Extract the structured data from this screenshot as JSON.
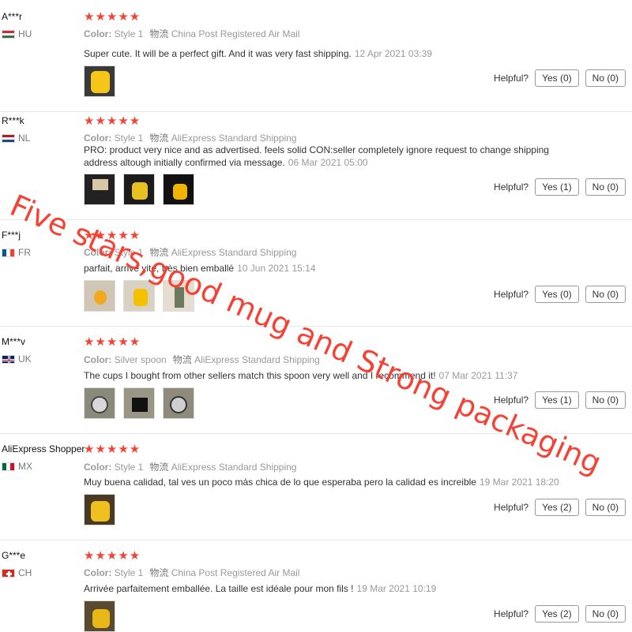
{
  "labels": {
    "color": "Color:",
    "helpful": "Helpful?",
    "shipping_prefix": "物流"
  },
  "colors": {
    "star": "#f44336",
    "overlay_text": "#f44336"
  },
  "overlay_text": "Five stars,good mug and Strong packaging",
  "reviews": [
    {
      "user": "A***r",
      "country": "HU",
      "flag": "hungary-flag-icon",
      "stars": "★★★★★",
      "color": "Style 1",
      "shipping": "China Post Registered Air Mail",
      "text": "Super cute. It will be a perfect gift. And it was very fast shipping.",
      "date": "12 Apr 2021 03:39",
      "yes": "Yes (0)",
      "no": "No (0)"
    },
    {
      "user": "R***k",
      "country": "NL",
      "flag": "netherlands-flag-icon",
      "stars": "★★★★★",
      "color": "Style 1",
      "shipping": "AliExpress Standard Shipping",
      "text": "PRO: product very nice and as advertised. feels solid CON:seller completely ignore request to change shipping address altough initially confirmed via message.",
      "date": "06 Mar 2021 05:00",
      "yes": "Yes (1)",
      "no": "No (0)"
    },
    {
      "user": "F***j",
      "country": "FR",
      "flag": "france-flag-icon",
      "stars": "★★★★★",
      "color": "Style 1",
      "shipping": "AliExpress Standard Shipping",
      "text": "parfait, arrivé vite, très bien emballé",
      "date": "10 Jun 2021 15:14",
      "yes": "Yes (0)",
      "no": "No (0)"
    },
    {
      "user": "M***v",
      "country": "UK",
      "flag": "uk-flag-icon",
      "stars": "★★★★★",
      "color": "Silver spoon",
      "shipping": "AliExpress Standard Shipping",
      "text": "The cups I bought from other sellers match this spoon very well and I recommend it!",
      "date": "07 Mar 2021 11:37",
      "yes": "Yes (1)",
      "no": "No (0)"
    },
    {
      "user": "AliExpress Shopper",
      "country": "MX",
      "flag": "mexico-flag-icon",
      "stars": "★★★★★",
      "color": "Style 1",
      "shipping": "AliExpress Standard Shipping",
      "text": "Muy buena calidad, tal ves un poco más chica de lo que esperaba pero la calidad es increible",
      "date": "19 Mar 2021 18:20",
      "yes": "Yes (2)",
      "no": "No (0)"
    },
    {
      "user": "G***e",
      "country": "CH",
      "flag": "switzerland-flag-icon",
      "stars": "★★★★★",
      "color": "Style 1",
      "shipping": "China Post Registered Air Mail",
      "text": "Arrivée parfaitement emballée. La taille est idéale pour mon fils !",
      "date": "19 Mar 2021 10:19",
      "yes": "Yes (2)",
      "no": "No (0)"
    }
  ]
}
